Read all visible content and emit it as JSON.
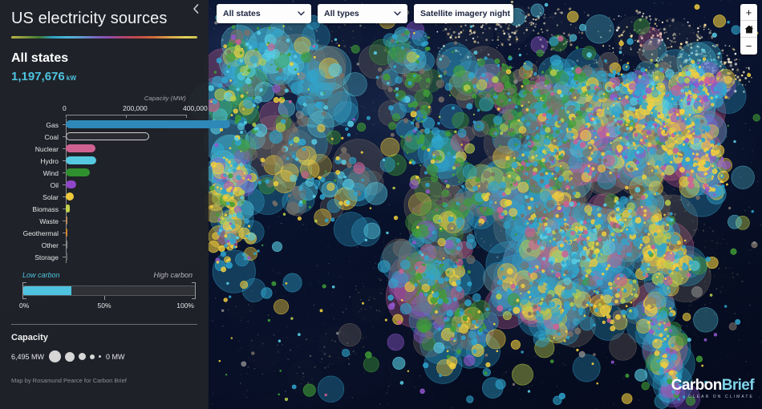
{
  "header": {
    "title": "US electricity sources",
    "collapse_icon": "chevron-left-icon"
  },
  "summary": {
    "state_label": "All states",
    "capacity_value": "1,197,676",
    "capacity_unit": "kW"
  },
  "chart_data": {
    "type": "bar",
    "title": "",
    "xlabel": "Capacity (MW)",
    "ylabel": "",
    "orientation": "horizontal",
    "xlim": [
      0,
      575000
    ],
    "xticks": [
      0,
      200000,
      400000
    ],
    "xtick_labels": [
      "0",
      "200,000",
      "400,000"
    ],
    "grid": false,
    "categories": [
      "Gas",
      "Coal",
      "Nuclear",
      "Hydro",
      "Wind",
      "Oil",
      "Solar",
      "Biomass",
      "Waste",
      "Geothermal",
      "Other",
      "Storage"
    ],
    "values": [
      546000,
      278000,
      98000,
      101000,
      80000,
      35000,
      26000,
      13000,
      4000,
      3000,
      1500,
      1000
    ],
    "colors": [
      "#2e89b9",
      "none",
      "#cf6191",
      "#55c9e0",
      "#2f8f2f",
      "#9046c8",
      "#efc93c",
      "#c3d44a",
      "#b98a5e",
      "#d0842f",
      "#8a8a8a",
      "#6a6a6a"
    ],
    "outlined": [
      "Coal"
    ]
  },
  "carbon": {
    "low_label": "Low carbon",
    "high_label": "High carbon",
    "fill_percent": 28,
    "ticks": [
      "0%",
      "50%",
      "100%"
    ]
  },
  "legend": {
    "title": "Capacity",
    "max_label": "6,495 MW",
    "min_label": "0 MW",
    "circle_sizes": [
      15,
      12,
      9,
      6,
      3
    ]
  },
  "credit": "Map by Rosamund Pearce for Carbon Brief",
  "controls": {
    "states": {
      "label": "All states",
      "icon": "chevron-down-icon"
    },
    "types": {
      "label": "All types",
      "icon": "chevron-down-icon"
    },
    "basemap": {
      "label": "Satellite imagery night",
      "icon": "chevron-down-icon"
    }
  },
  "map_controls": {
    "zoom_in": "+",
    "home": "home-icon",
    "zoom_out": "−"
  },
  "logo": {
    "name_a": "Carbon",
    "name_b": "Brief",
    "tagline": "CLEAR ON CLIMATE"
  }
}
